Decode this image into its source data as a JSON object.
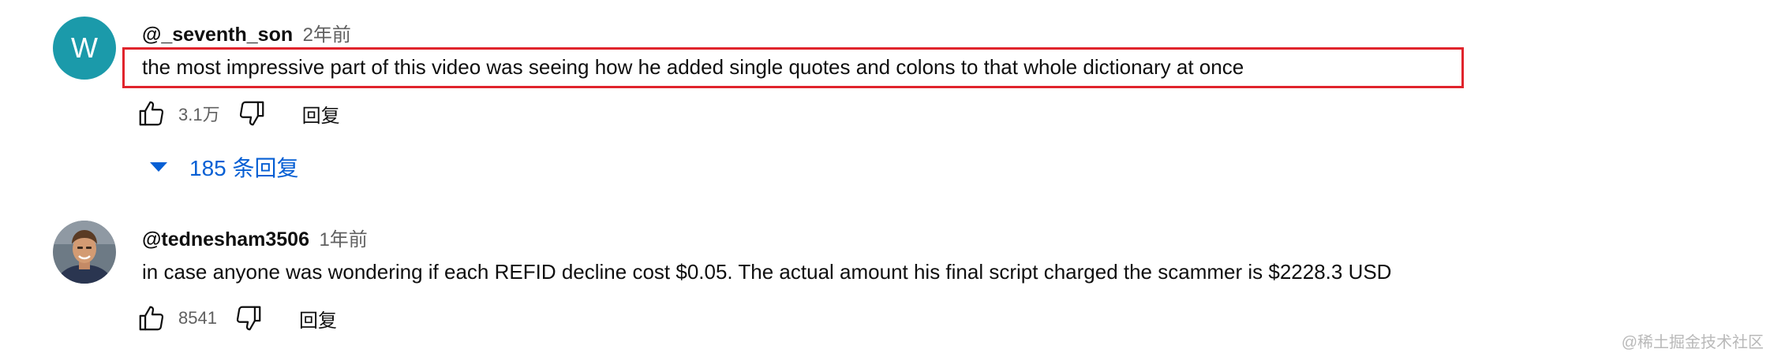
{
  "comments": [
    {
      "avatar_letter": "W",
      "avatar_color": "#1b9aaa",
      "author": "@_seventh_son",
      "time": "2年前",
      "text": "the most impressive part of this video was seeing how he added single quotes and colons to that whole dictionary at once",
      "likes": "3.1万",
      "reply_label": "回复",
      "replies_label": "185 条回复",
      "highlighted": true
    },
    {
      "avatar_icon": "person-photo-avatar",
      "author": "@tednesham3506",
      "time": "1年前",
      "text": "in case anyone was wondering if each REFID decline cost $0.05. The actual amount his final script charged the scammer is $2228.3 USD",
      "likes": "8541",
      "reply_label": "回复"
    }
  ],
  "watermark": "@稀土掘金技术社区",
  "colors": {
    "highlight_border": "#e0242c",
    "link_blue": "#065fd4",
    "meta_gray": "#606060"
  }
}
